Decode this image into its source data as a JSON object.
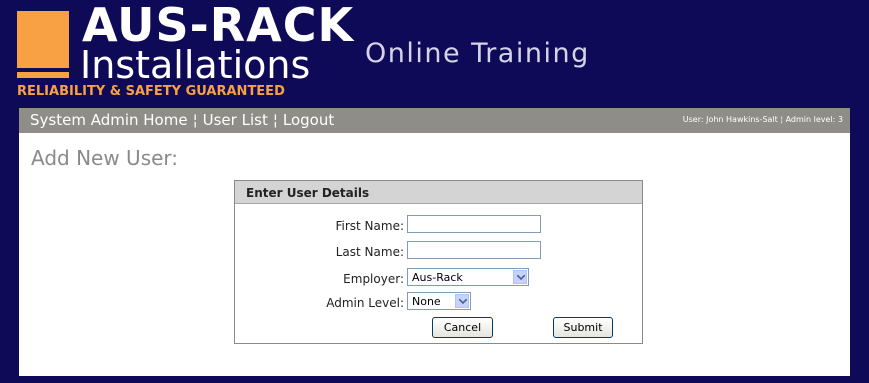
{
  "header": {
    "logo_line1": "AUS-RACK",
    "logo_line2": "Installations",
    "logo_tagline": "RELIABILITY & SAFETY GUARANTEED",
    "app_title": "Online Training"
  },
  "nav": {
    "links": [
      "System Admin Home",
      "User List",
      "Logout"
    ],
    "separator": "¦",
    "user_info": "User: John Hawkins-Salt ¦ Admin level: 3"
  },
  "page": {
    "title": "Add New User:"
  },
  "form": {
    "header": "Enter User Details",
    "first_name_label": "First Name:",
    "first_name_value": "",
    "last_name_label": "Last Name:",
    "last_name_value": "",
    "employer_label": "Employer:",
    "employer_value": "Aus-Rack",
    "admin_level_label": "Admin Level:",
    "admin_level_value": "None",
    "cancel_label": "Cancel",
    "submit_label": "Submit"
  },
  "colors": {
    "background": "#0f0a57",
    "brand_orange": "#f7a144",
    "navbar": "#8e8d88"
  },
  "icons": [
    "chevron-down-icon"
  ]
}
